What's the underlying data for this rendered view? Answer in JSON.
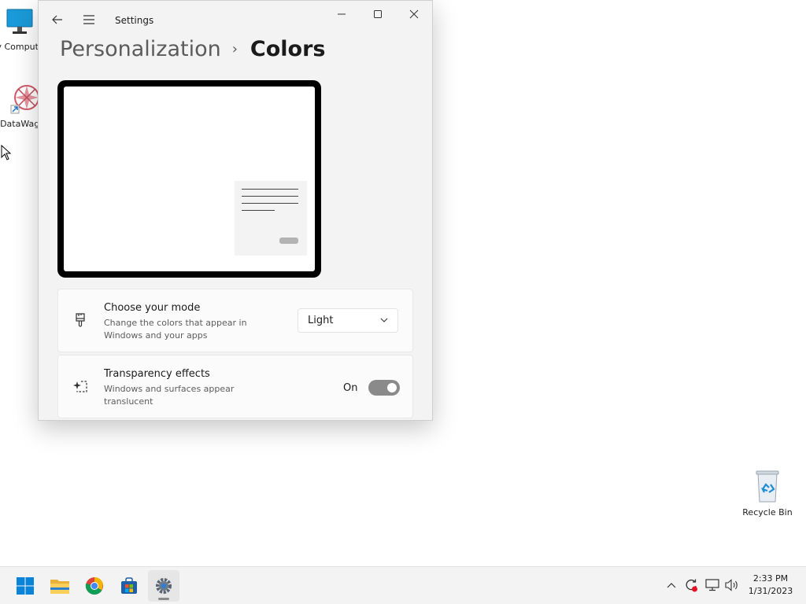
{
  "desktop": {
    "icons": [
      {
        "label": "My Computer",
        "icon": "monitor-icon"
      },
      {
        "label": "DataWagon",
        "icon": "datawagon-icon"
      },
      {
        "label": "Recycle Bin",
        "icon": "recycle-bin-icon"
      }
    ]
  },
  "window": {
    "title": "Settings",
    "breadcrumb": {
      "parent": "Personalization",
      "separator": "›",
      "current": "Colors"
    }
  },
  "mode_card": {
    "title": "Choose your mode",
    "description": "Change the colors that appear in Windows and your apps",
    "selected": "Light",
    "icon": "brush-icon"
  },
  "transparency_card": {
    "title": "Transparency effects",
    "description": "Windows and surfaces appear translucent",
    "state_label": "On",
    "enabled": true,
    "icon": "sparkle-icon"
  },
  "taskbar": {
    "apps": [
      "start-icon",
      "file-explorer-icon",
      "chrome-icon",
      "store-icon",
      "settings-icon"
    ],
    "active_app": "settings-icon",
    "clock": {
      "time": "2:33 PM",
      "date": "1/31/2023"
    }
  },
  "colors": {
    "accent": "#0067c0",
    "toggle_on": "#8a8a8a",
    "window_bg": "#f3f3f3"
  }
}
